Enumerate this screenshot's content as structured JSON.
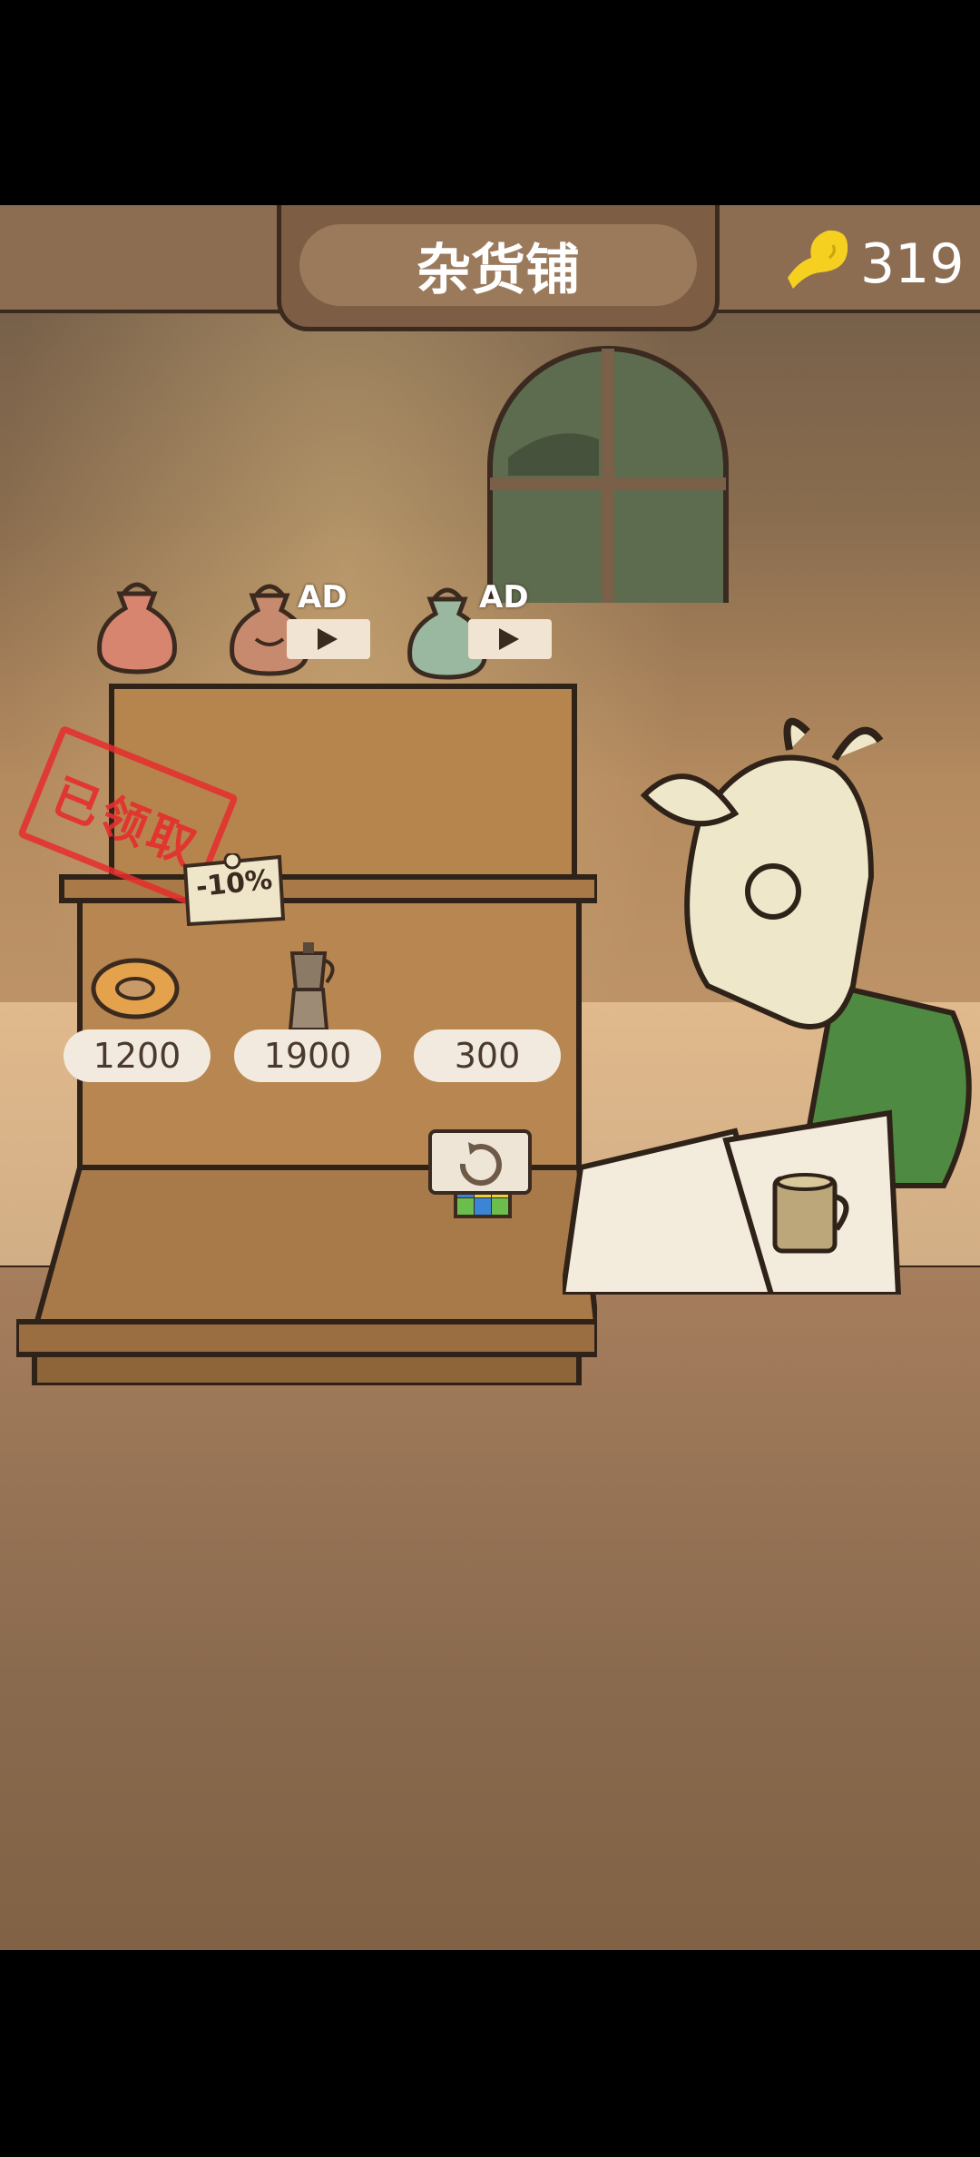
{
  "header": {
    "title": "杂货铺",
    "coins": "319",
    "coin_icon": "fish-icon"
  },
  "shelf": {
    "top_row": [
      {
        "name": "red-bag",
        "color": "#d88570",
        "state": "已领取",
        "badge": ""
      },
      {
        "name": "brown-bag",
        "color": "#c88a6e",
        "badge": "AD"
      },
      {
        "name": "green-bag",
        "color": "#9ab89f",
        "badge": "AD"
      }
    ],
    "discount_sign": "-10%",
    "items": [
      {
        "name": "donut",
        "price": "1200"
      },
      {
        "name": "moka-pot",
        "price": "1900"
      },
      {
        "name": "rubiks-cube",
        "price": "300"
      }
    ],
    "refresh_icon": "refresh-icon"
  },
  "bottom": {
    "inventory_icon": "bag-icon",
    "exit_icon": "exit-door-icon"
  },
  "colors": {
    "stamp": "#e62d2d",
    "ad_badge": "#f2e4d2",
    "coin_fish": "#f5d020"
  }
}
